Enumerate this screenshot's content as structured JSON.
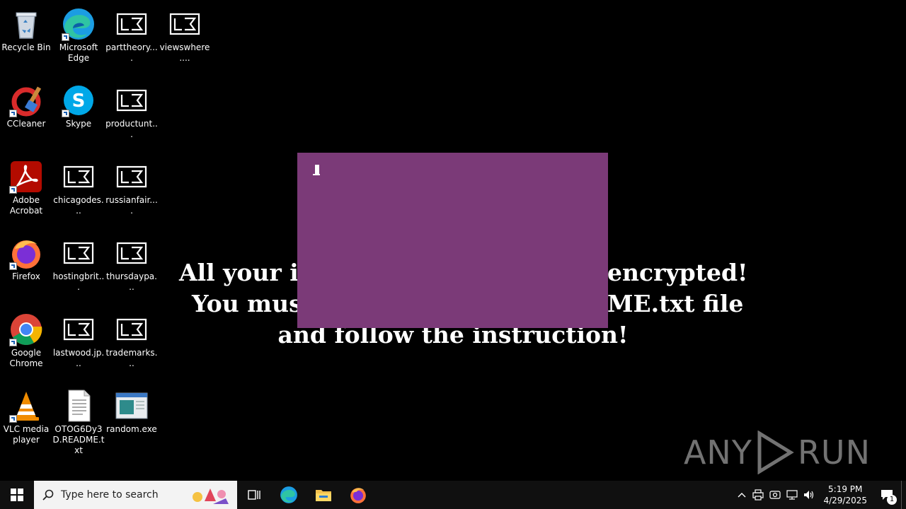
{
  "desktop": {
    "icons": [
      {
        "label": "Recycle Bin",
        "icon": "recycle-bin-icon"
      },
      {
        "label": "Microsoft Edge",
        "icon": "edge-icon"
      },
      {
        "label": "parttheory....",
        "icon": "generic-file-icon"
      },
      {
        "label": "viewswhere....",
        "icon": "generic-file-icon"
      },
      {
        "label": "CCleaner",
        "icon": "ccleaner-icon"
      },
      {
        "label": "Skype",
        "icon": "skype-icon"
      },
      {
        "label": "productunt...",
        "icon": "generic-file-icon"
      },
      {
        "label": "Adobe Acrobat",
        "icon": "acrobat-icon"
      },
      {
        "label": "chicagodes...",
        "icon": "generic-file-icon"
      },
      {
        "label": "russianfair....",
        "icon": "generic-file-icon"
      },
      {
        "label": "Firefox",
        "icon": "firefox-icon"
      },
      {
        "label": "hostingbrit...",
        "icon": "generic-file-icon"
      },
      {
        "label": "thursdaypa...",
        "icon": "generic-file-icon"
      },
      {
        "label": "Google Chrome",
        "icon": "chrome-icon"
      },
      {
        "label": "lastwood.jp...",
        "icon": "generic-file-icon"
      },
      {
        "label": "trademarks...",
        "icon": "generic-file-icon"
      },
      {
        "label": "VLC media player",
        "icon": "vlc-icon"
      },
      {
        "label": "OTOG6Dy3D.README.txt",
        "icon": "text-file-icon"
      },
      {
        "label": "random.exe",
        "icon": "exe-icon"
      }
    ]
  },
  "ransom_note": {
    "line1_left": "All your im",
    "line1_right": "encrypted!",
    "line2_left": "You must",
    "line2_right": "ME.txt file",
    "line3": "and follow the instruction!"
  },
  "watermark": {
    "left": "ANY",
    "right": "RUN"
  },
  "taskbar": {
    "search_placeholder": "Type here to search",
    "time": "5:19 PM",
    "date": "4/29/2025",
    "notification_count": "1"
  },
  "colors": {
    "popup": "#7b3a78",
    "taskbar": "#101010",
    "search": "#f3f3f3"
  }
}
